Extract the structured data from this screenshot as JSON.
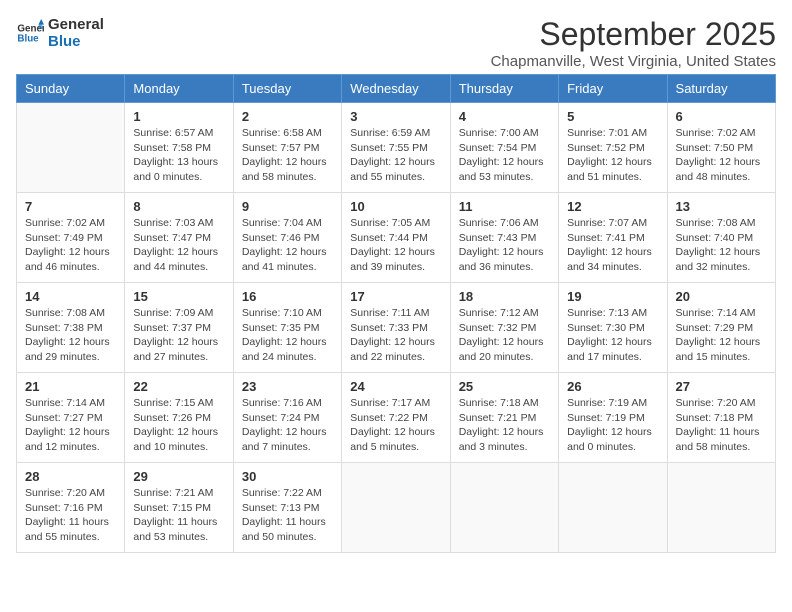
{
  "logo": {
    "line1": "General",
    "line2": "Blue"
  },
  "title": "September 2025",
  "subtitle": "Chapmanville, West Virginia, United States",
  "weekdays": [
    "Sunday",
    "Monday",
    "Tuesday",
    "Wednesday",
    "Thursday",
    "Friday",
    "Saturday"
  ],
  "weeks": [
    [
      {
        "day": "",
        "info": ""
      },
      {
        "day": "1",
        "info": "Sunrise: 6:57 AM\nSunset: 7:58 PM\nDaylight: 13 hours\nand 0 minutes."
      },
      {
        "day": "2",
        "info": "Sunrise: 6:58 AM\nSunset: 7:57 PM\nDaylight: 12 hours\nand 58 minutes."
      },
      {
        "day": "3",
        "info": "Sunrise: 6:59 AM\nSunset: 7:55 PM\nDaylight: 12 hours\nand 55 minutes."
      },
      {
        "day": "4",
        "info": "Sunrise: 7:00 AM\nSunset: 7:54 PM\nDaylight: 12 hours\nand 53 minutes."
      },
      {
        "day": "5",
        "info": "Sunrise: 7:01 AM\nSunset: 7:52 PM\nDaylight: 12 hours\nand 51 minutes."
      },
      {
        "day": "6",
        "info": "Sunrise: 7:02 AM\nSunset: 7:50 PM\nDaylight: 12 hours\nand 48 minutes."
      }
    ],
    [
      {
        "day": "7",
        "info": "Sunrise: 7:02 AM\nSunset: 7:49 PM\nDaylight: 12 hours\nand 46 minutes."
      },
      {
        "day": "8",
        "info": "Sunrise: 7:03 AM\nSunset: 7:47 PM\nDaylight: 12 hours\nand 44 minutes."
      },
      {
        "day": "9",
        "info": "Sunrise: 7:04 AM\nSunset: 7:46 PM\nDaylight: 12 hours\nand 41 minutes."
      },
      {
        "day": "10",
        "info": "Sunrise: 7:05 AM\nSunset: 7:44 PM\nDaylight: 12 hours\nand 39 minutes."
      },
      {
        "day": "11",
        "info": "Sunrise: 7:06 AM\nSunset: 7:43 PM\nDaylight: 12 hours\nand 36 minutes."
      },
      {
        "day": "12",
        "info": "Sunrise: 7:07 AM\nSunset: 7:41 PM\nDaylight: 12 hours\nand 34 minutes."
      },
      {
        "day": "13",
        "info": "Sunrise: 7:08 AM\nSunset: 7:40 PM\nDaylight: 12 hours\nand 32 minutes."
      }
    ],
    [
      {
        "day": "14",
        "info": "Sunrise: 7:08 AM\nSunset: 7:38 PM\nDaylight: 12 hours\nand 29 minutes."
      },
      {
        "day": "15",
        "info": "Sunrise: 7:09 AM\nSunset: 7:37 PM\nDaylight: 12 hours\nand 27 minutes."
      },
      {
        "day": "16",
        "info": "Sunrise: 7:10 AM\nSunset: 7:35 PM\nDaylight: 12 hours\nand 24 minutes."
      },
      {
        "day": "17",
        "info": "Sunrise: 7:11 AM\nSunset: 7:33 PM\nDaylight: 12 hours\nand 22 minutes."
      },
      {
        "day": "18",
        "info": "Sunrise: 7:12 AM\nSunset: 7:32 PM\nDaylight: 12 hours\nand 20 minutes."
      },
      {
        "day": "19",
        "info": "Sunrise: 7:13 AM\nSunset: 7:30 PM\nDaylight: 12 hours\nand 17 minutes."
      },
      {
        "day": "20",
        "info": "Sunrise: 7:14 AM\nSunset: 7:29 PM\nDaylight: 12 hours\nand 15 minutes."
      }
    ],
    [
      {
        "day": "21",
        "info": "Sunrise: 7:14 AM\nSunset: 7:27 PM\nDaylight: 12 hours\nand 12 minutes."
      },
      {
        "day": "22",
        "info": "Sunrise: 7:15 AM\nSunset: 7:26 PM\nDaylight: 12 hours\nand 10 minutes."
      },
      {
        "day": "23",
        "info": "Sunrise: 7:16 AM\nSunset: 7:24 PM\nDaylight: 12 hours\nand 7 minutes."
      },
      {
        "day": "24",
        "info": "Sunrise: 7:17 AM\nSunset: 7:22 PM\nDaylight: 12 hours\nand 5 minutes."
      },
      {
        "day": "25",
        "info": "Sunrise: 7:18 AM\nSunset: 7:21 PM\nDaylight: 12 hours\nand 3 minutes."
      },
      {
        "day": "26",
        "info": "Sunrise: 7:19 AM\nSunset: 7:19 PM\nDaylight: 12 hours\nand 0 minutes."
      },
      {
        "day": "27",
        "info": "Sunrise: 7:20 AM\nSunset: 7:18 PM\nDaylight: 11 hours\nand 58 minutes."
      }
    ],
    [
      {
        "day": "28",
        "info": "Sunrise: 7:20 AM\nSunset: 7:16 PM\nDaylight: 11 hours\nand 55 minutes."
      },
      {
        "day": "29",
        "info": "Sunrise: 7:21 AM\nSunset: 7:15 PM\nDaylight: 11 hours\nand 53 minutes."
      },
      {
        "day": "30",
        "info": "Sunrise: 7:22 AM\nSunset: 7:13 PM\nDaylight: 11 hours\nand 50 minutes."
      },
      {
        "day": "",
        "info": ""
      },
      {
        "day": "",
        "info": ""
      },
      {
        "day": "",
        "info": ""
      },
      {
        "day": "",
        "info": ""
      }
    ]
  ]
}
